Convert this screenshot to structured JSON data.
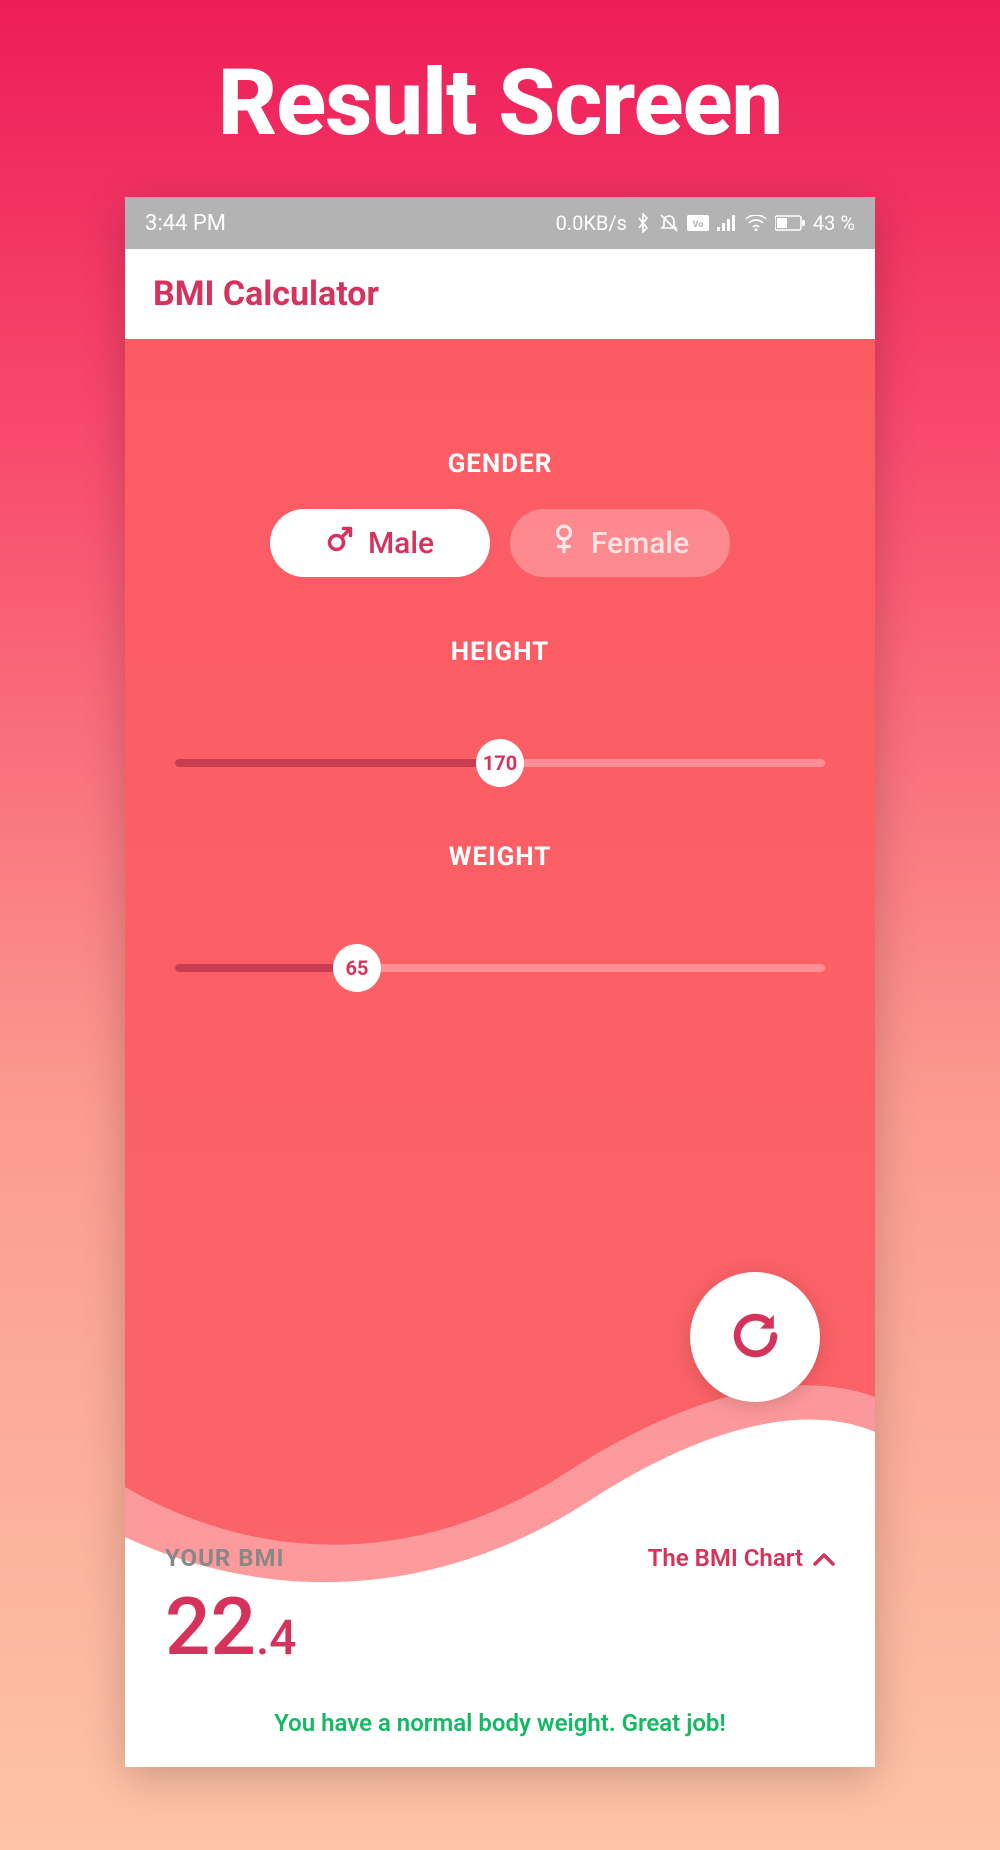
{
  "page": {
    "title": "Result Screen"
  },
  "status_bar": {
    "time": "3:44 PM",
    "data_rate": "0.0KB/s",
    "battery": "43 %"
  },
  "app_bar": {
    "title": "BMI Calculator"
  },
  "gender": {
    "label": "GENDER",
    "male": "Male",
    "female": "Female",
    "selected": "male"
  },
  "height": {
    "label": "HEIGHT",
    "value": "170",
    "percent": 50
  },
  "weight": {
    "label": "WEIGHT",
    "value": "65",
    "percent": 28
  },
  "result": {
    "your_bmi_label": "YOUR BMI",
    "chart_link": "The BMI Chart",
    "bmi_int": "22",
    "bmi_dec": ".4",
    "message": "You have a normal body weight. Great job!"
  },
  "colors": {
    "accent": "#d6335c",
    "success": "#15b864"
  }
}
